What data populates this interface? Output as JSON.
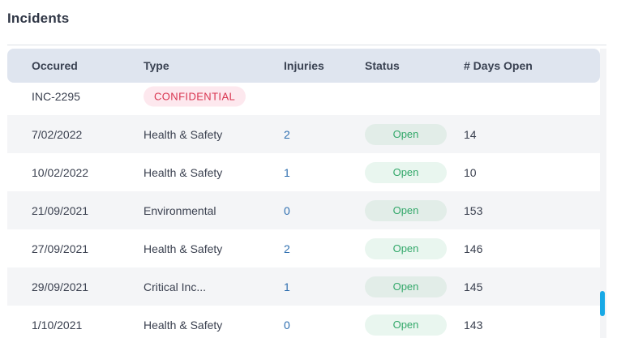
{
  "panel": {
    "title": "Incidents"
  },
  "table": {
    "columns": [
      "Occured",
      "Type",
      "Injuries",
      "Status",
      "# Days Open"
    ],
    "first_row": {
      "occurred": "INC-2295",
      "badge": "CONFIDENTIAL"
    },
    "rows": [
      {
        "occurred": "7/02/2022",
        "type": "Health & Safety",
        "injuries": "2",
        "status": "Open",
        "days_open": "14"
      },
      {
        "occurred": "10/02/2022",
        "type": "Health & Safety",
        "injuries": "1",
        "status": "Open",
        "days_open": "10"
      },
      {
        "occurred": "21/09/2021",
        "type": "Environmental",
        "injuries": "0",
        "status": "Open",
        "days_open": "153"
      },
      {
        "occurred": "27/09/2021",
        "type": "Health & Safety",
        "injuries": "2",
        "status": "Open",
        "days_open": "146"
      },
      {
        "occurred": "29/09/2021",
        "type": "Critical Inc...",
        "injuries": "1",
        "status": "Open",
        "days_open": "145"
      },
      {
        "occurred": "1/10/2021",
        "type": "Health & Safety",
        "injuries": "0",
        "status": "Open",
        "days_open": "143"
      }
    ]
  },
  "colors": {
    "header_bg": "#dfe5ef",
    "alt_row_bg": "#f4f5f7",
    "status_green": "#33a86a",
    "confidential_red": "#d8344f",
    "link_blue": "#2f6fb0",
    "scrollbar_accent": "#18a9e6"
  }
}
